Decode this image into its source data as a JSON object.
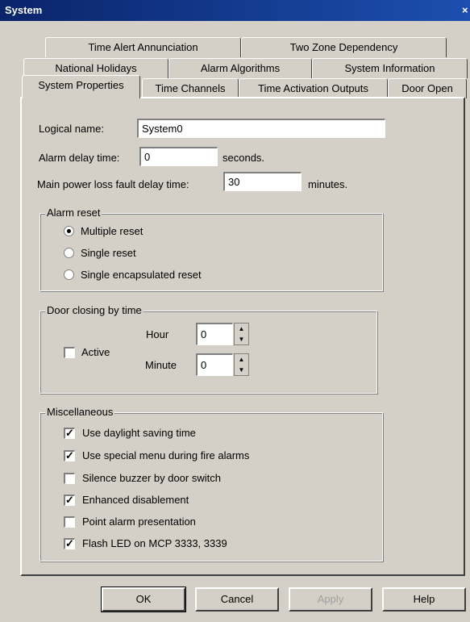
{
  "window": {
    "title": "System",
    "close_glyph": "×"
  },
  "tabs": {
    "row1": [
      "Time Alert Annunciation",
      "Two Zone Dependency"
    ],
    "row2": [
      "National Holidays",
      "Alarm Algorithms",
      "System Information"
    ],
    "row3": [
      "System Properties",
      "Time Channels",
      "Time Activation Outputs",
      "Door Open"
    ],
    "active": "System Properties"
  },
  "fields": {
    "logical_name_label": "Logical name:",
    "logical_name_value": "System0",
    "alarm_delay_label": "Alarm delay time:",
    "alarm_delay_value": "0",
    "alarm_delay_unit": "seconds.",
    "power_loss_label": "Main power loss fault delay time:",
    "power_loss_value": "30",
    "power_loss_unit": "minutes."
  },
  "alarm_reset": {
    "label": "Alarm reset",
    "options": [
      {
        "label": "Multiple reset",
        "selected": true
      },
      {
        "label": "Single reset",
        "selected": false
      },
      {
        "label": "Single encapsulated reset",
        "selected": false
      }
    ]
  },
  "door_closing": {
    "label": "Door closing by time",
    "active_label": "Active",
    "active_checked": false,
    "hour_label": "Hour",
    "hour_value": "0",
    "minute_label": "Minute",
    "minute_value": "0"
  },
  "misc": {
    "label": "Miscellaneous",
    "options": [
      {
        "label": "Use daylight saving time",
        "checked": true
      },
      {
        "label": "Use special menu during fire alarms",
        "checked": true
      },
      {
        "label": "Silence buzzer by door switch",
        "checked": false
      },
      {
        "label": "Enhanced disablement",
        "checked": true
      },
      {
        "label": "Point alarm presentation",
        "checked": false
      },
      {
        "label": "Flash LED on MCP 3333, 3339",
        "checked": true
      }
    ]
  },
  "buttons": {
    "ok": "OK",
    "cancel": "Cancel",
    "apply": "Apply",
    "help": "Help"
  },
  "check_glyph": "✓",
  "spin_up_glyph": "▲",
  "spin_down_glyph": "▼"
}
